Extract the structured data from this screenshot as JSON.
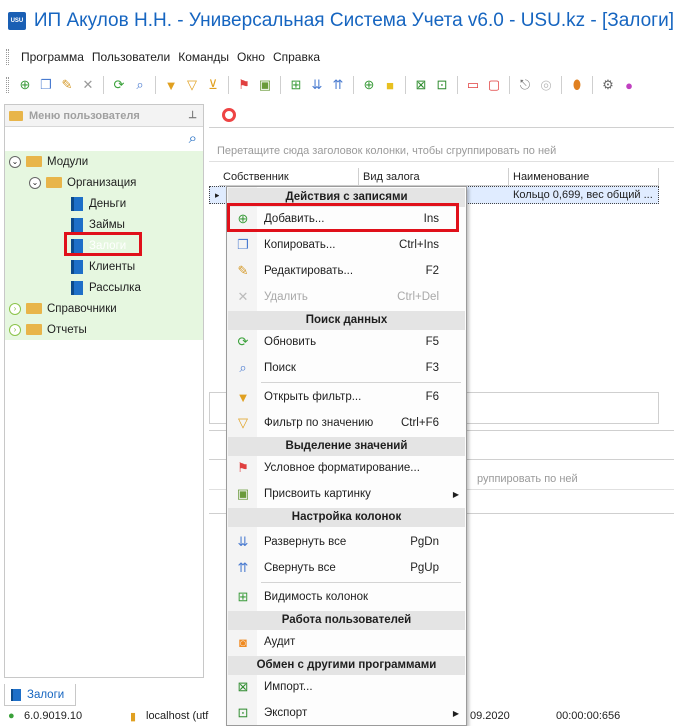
{
  "window": {
    "title": "ИП Акулов Н.Н. - Универсальная Система Учета v6.0 - USU.kz - [Залоги]",
    "app_icon": "USU"
  },
  "menu": [
    "Программа",
    "Пользователи",
    "Команды",
    "Окно",
    "Справка"
  ],
  "toolbar_icons": [
    "add-icon",
    "copy-icon",
    "edit-icon",
    "delete-icon",
    "refresh-icon",
    "search-icon",
    "filter-icon",
    "filter-value-icon",
    "clear-filter-icon",
    "flag-icon",
    "picture-icon",
    "expand-icon",
    "collapse-icon",
    "columns-icon",
    "note-icon",
    "export-icon",
    "import-icon",
    "window-icon",
    "window2-icon",
    "exit-icon",
    "lock-icon",
    "location-icon",
    "settings-icon",
    "color-icon"
  ],
  "sidebar": {
    "header": "Меню пользователя",
    "tree": {
      "modules": "Модули",
      "organization": "Организация",
      "items": [
        "Деньги",
        "Займы",
        "Залоги",
        "Клиенты",
        "Рассылка"
      ],
      "directories": "Справочники",
      "reports": "Отчеты"
    }
  },
  "grid": {
    "group_hint": "Перетащите сюда заголовок колонки, чтобы сгруппировать по ней",
    "columns": [
      "Собственник",
      "Вид залога",
      "Наименование"
    ],
    "row_name": "Кольцо 0,699, вес общий ..."
  },
  "lower_grid": {
    "group_hint_tail": "руппировать по ней"
  },
  "context_menu": {
    "section_records": "Действия с записями",
    "add": {
      "label": "Добавить...",
      "shortcut": "Ins"
    },
    "copy": {
      "label": "Копировать...",
      "shortcut": "Ctrl+Ins"
    },
    "edit": {
      "label": "Редактировать...",
      "shortcut": "F2"
    },
    "delete": {
      "label": "Удалить",
      "shortcut": "Ctrl+Del"
    },
    "section_search": "Поиск данных",
    "refresh": {
      "label": "Обновить",
      "shortcut": "F5"
    },
    "search": {
      "label": "Поиск",
      "shortcut": "F3"
    },
    "open_filter": {
      "label": "Открыть фильтр...",
      "shortcut": "F6"
    },
    "filter_value": {
      "label": "Фильтр по значению",
      "shortcut": "Ctrl+F6"
    },
    "section_highlight": "Выделение значений",
    "cond_format": {
      "label": "Условное форматирование..."
    },
    "assign_picture": {
      "label": "Присвоить картинку"
    },
    "section_columns": "Настройка колонок",
    "expand_all": {
      "label": "Развернуть все",
      "shortcut": "PgDn"
    },
    "collapse_all": {
      "label": "Свернуть все",
      "shortcut": "PgUp"
    },
    "col_visibility": {
      "label": "Видимость колонок"
    },
    "section_users": "Работа пользователей",
    "audit": {
      "label": "Аудит"
    },
    "section_exchange": "Обмен с другими программами",
    "import": {
      "label": "Импорт..."
    },
    "export": {
      "label": "Экспорт"
    }
  },
  "bottom_tab": "Залоги",
  "status": {
    "version": "6.0.9019.10",
    "db": "localhost (utf",
    "date": "09.2020",
    "timer": "00:00:00:656"
  },
  "colors": {
    "title_blue": "#1665c0",
    "highlight_red": "#e0101a",
    "tree_green": "#e6f7e0"
  }
}
